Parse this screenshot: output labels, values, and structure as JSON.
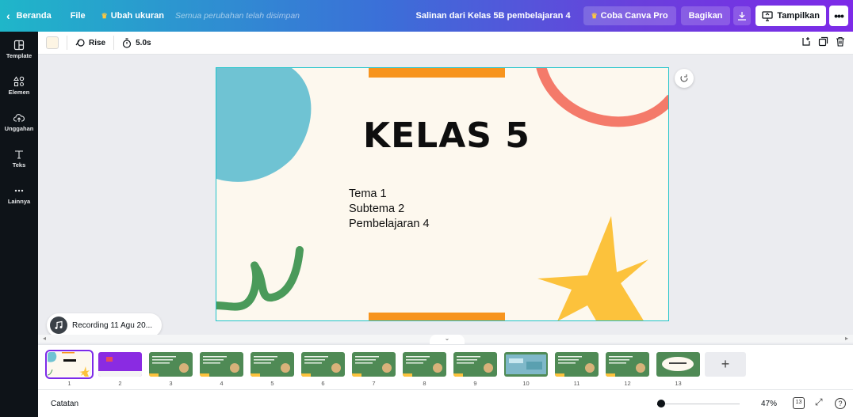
{
  "topbar": {
    "home_label": "Beranda",
    "file_label": "File",
    "resize_label": "Ubah ukuran",
    "saved_status": "Semua perubahan telah disimpan",
    "doc_title": "Salinan dari Kelas 5B pembelajaran 4",
    "pro_label": "Coba Canva Pro",
    "share_label": "Bagikan",
    "present_label": "Tampilkan",
    "more_label": "•••"
  },
  "sidebar": {
    "items": [
      {
        "label": "Template",
        "icon": "template-icon"
      },
      {
        "label": "Elemen",
        "icon": "elements-icon"
      },
      {
        "label": "Unggahan",
        "icon": "upload-icon"
      },
      {
        "label": "Teks",
        "icon": "text-icon"
      },
      {
        "label": "Lainnya",
        "icon": "more-icon"
      }
    ]
  },
  "toolbar": {
    "animation_label": "Rise",
    "duration_label": "5.0s"
  },
  "slide": {
    "title": "KELAS 5",
    "line1": "Tema 1",
    "line2": "Subtema 2",
    "line3": "Pembelajaran 4"
  },
  "audio": {
    "label": "Recording 11 Agu 20..."
  },
  "filmstrip": {
    "pages": [
      "1",
      "2",
      "3",
      "4",
      "5",
      "6",
      "7",
      "8",
      "9",
      "10",
      "11",
      "12",
      "13"
    ],
    "add_label": "+"
  },
  "bottombar": {
    "notes_label": "Catatan",
    "zoom_label": "47%",
    "page_count": "13",
    "zoom_level": 0.47
  },
  "colors": {
    "accent": "#7d2ae8",
    "slide_bg": "#fdf8ee",
    "teal": "#6fc3d3",
    "coral": "#f47a6a",
    "orange": "#f7941d",
    "green": "#4a9a5a",
    "yellow": "#fcc23c"
  }
}
